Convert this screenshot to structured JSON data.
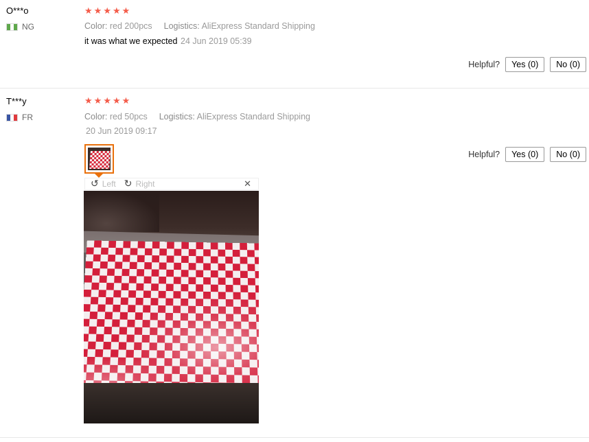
{
  "reviews": [
    {
      "user": "O***o",
      "country": "NG",
      "flag_colors": [
        "#5fa84c",
        "#ffffff",
        "#5fa84c"
      ],
      "stars": 5,
      "star_color": "#f45c4a",
      "color_key": "Color:",
      "color_value": "red 200pcs",
      "logistics_key": "Logistics:",
      "logistics_value": "AliExpress Standard Shipping",
      "feedback": "it was what we expected",
      "date": "24 Jun 2019 05:39",
      "helpful_label": "Helpful?",
      "yes_label": "Yes (0)",
      "no_label": "No (0)"
    },
    {
      "user": "T***y",
      "country": "FR",
      "flag_colors": [
        "#3a55a4",
        "#ffffff",
        "#e03a3e"
      ],
      "stars": 5,
      "star_color": "#f45c4a",
      "color_key": "Color:",
      "color_value": "red 50pcs",
      "logistics_key": "Logistics:",
      "logistics_value": "AliExpress Standard Shipping",
      "date": "20 Jun 2019 09:17",
      "helpful_label": "Helpful?",
      "yes_label": "Yes (0)",
      "no_label": "No (0)",
      "viewer": {
        "left_label": "Left",
        "right_label": "Right",
        "rotate_left_icon": "rotate-left-icon",
        "rotate_right_icon": "rotate-right-icon",
        "close_icon": "close-icon"
      }
    }
  ]
}
